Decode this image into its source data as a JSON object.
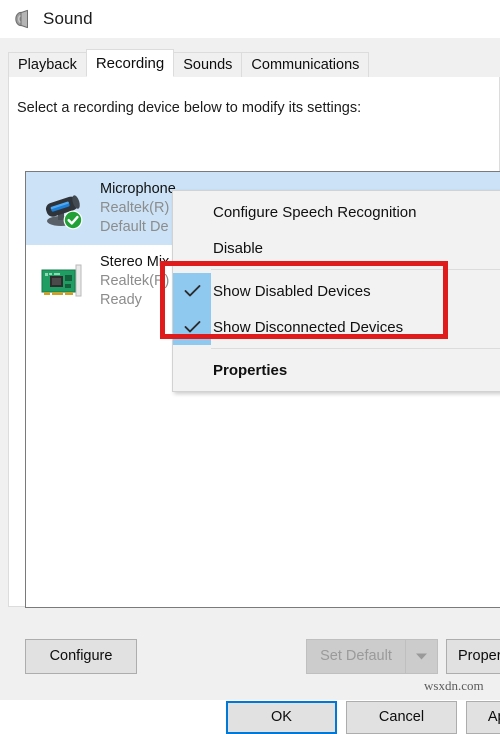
{
  "window": {
    "title": "Sound",
    "icon": "speaker-icon"
  },
  "tabs": [
    {
      "label": "Playback",
      "active": false
    },
    {
      "label": "Recording",
      "active": true
    },
    {
      "label": "Sounds",
      "active": false
    },
    {
      "label": "Communications",
      "active": false
    }
  ],
  "recording_tab": {
    "hint": "Select a recording device below to modify its settings:",
    "devices": [
      {
        "name": "Microphone",
        "driver": "Realtek(R) Audio",
        "status": "Default De",
        "icon": "microphone-icon",
        "badge": "green-check-badge",
        "selected": true
      },
      {
        "name": "Stereo Mix",
        "driver": "Realtek(R)",
        "status": "Ready",
        "icon": "sound-card-icon",
        "badge": "",
        "selected": false
      }
    ],
    "buttons": {
      "configure": "Configure",
      "set_default": "Set Default",
      "set_default_arrow": "chevron-down-icon",
      "properties": "Properties"
    }
  },
  "context_menu": {
    "items": [
      {
        "label": "Configure Speech Recognition",
        "checked": false,
        "bold": false,
        "separator_before": false
      },
      {
        "label": "Disable",
        "checked": false,
        "bold": false,
        "separator_before": false
      },
      {
        "label": "Show Disabled Devices",
        "checked": true,
        "bold": false,
        "separator_before": true
      },
      {
        "label": "Show Disconnected Devices",
        "checked": true,
        "bold": false,
        "separator_before": false
      },
      {
        "label": "Properties",
        "checked": false,
        "bold": true,
        "separator_before": true
      }
    ]
  },
  "annotation": {
    "color": "#e01b1b",
    "shape": "rectangle"
  },
  "footer": {
    "ok": "OK",
    "cancel": "Cancel",
    "apply": "Apply"
  },
  "watermark": {
    "text": "wsxdn.com"
  },
  "colors": {
    "selection": "#cce3f7",
    "check_highlight": "#8fc9ef",
    "focus_border": "#0078d7",
    "annotation": "#e01b1b",
    "default_badge": "#21a038"
  }
}
